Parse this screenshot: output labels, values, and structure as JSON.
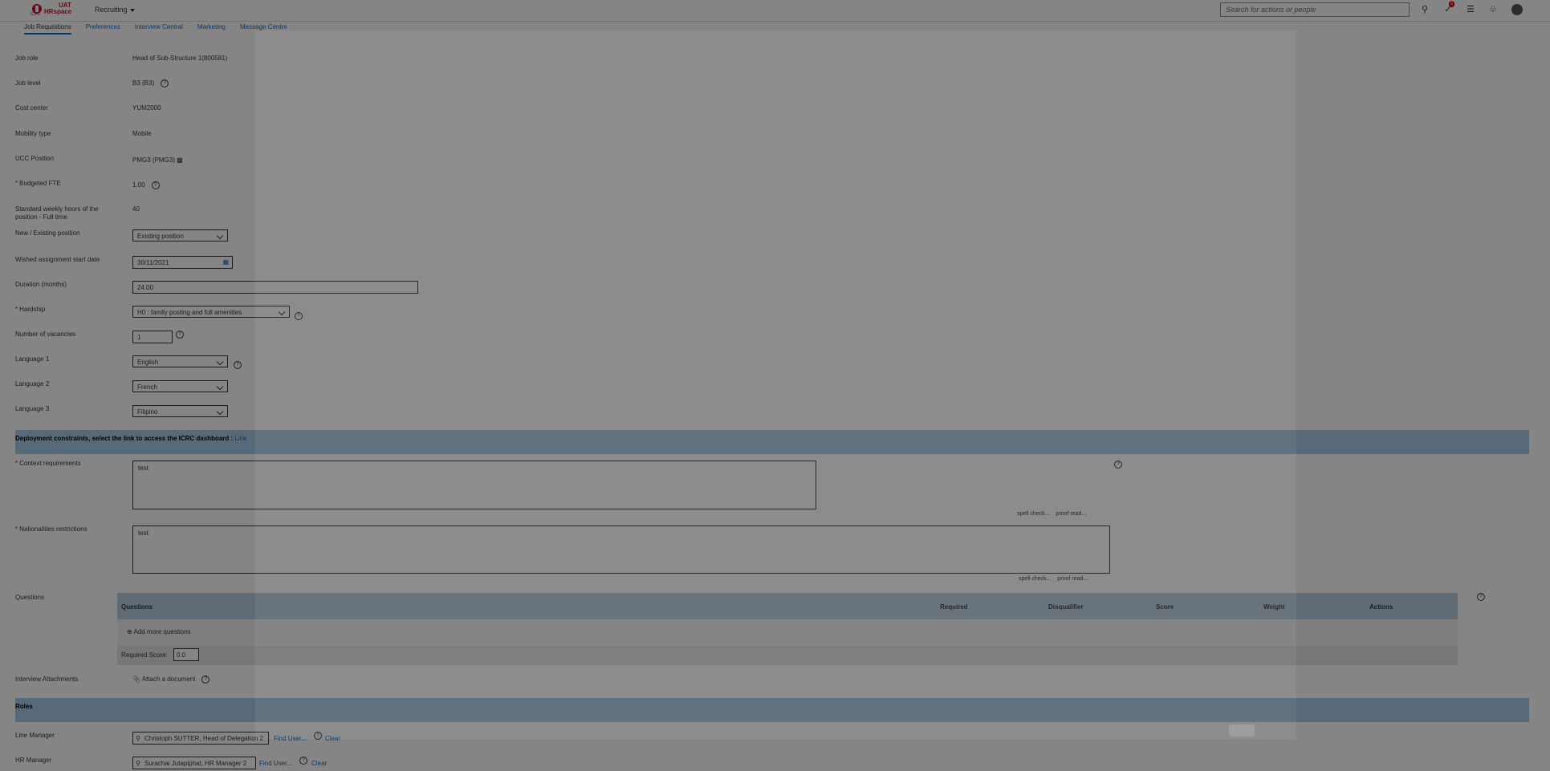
{
  "header": {
    "brand_top": "UAT",
    "brand_bottom": "HRspace",
    "brand_small": "ICRC",
    "module": "Recruiting",
    "search_placeholder": "Search for actions or people",
    "notification_count": "5"
  },
  "tabs": [
    "Job Requisitions",
    "Preferences",
    "Interview Central",
    "Marketing",
    "Message Centre"
  ],
  "fields": {
    "job_role": {
      "label": "Job role",
      "value": "Head of Sub-Structure 1(800581)"
    },
    "job_level": {
      "label": "Job level",
      "value": "B3 (B3)"
    },
    "cost_center": {
      "label": "Cost center",
      "value": "YUM2000"
    },
    "mobility_type": {
      "label": "Mobility type",
      "value": "Mobile"
    },
    "ucc_position": {
      "label": "UCC Position",
      "value": "PMG3 (PMG3)"
    },
    "budgeted_fte": {
      "label": "Budgeted FTE",
      "value": "1.00"
    },
    "weekly_hours": {
      "label": "Standard weekly hours of the position - Full time",
      "value": "40"
    },
    "new_existing": {
      "label": "New / Existing position",
      "value": "Existing position"
    },
    "start_date": {
      "label": "Wished assignment start date",
      "value": "30/11/2021"
    },
    "duration": {
      "label": "Duration (months)",
      "value": "24.00"
    },
    "hardship": {
      "label": "Hardship",
      "value": "H0 : family posting and full amenities"
    },
    "vacancies": {
      "label": "Number of vacancies",
      "value": "1"
    },
    "language1": {
      "label": "Language 1",
      "value": "English"
    },
    "language2": {
      "label": "Language 2",
      "value": "French"
    },
    "language3": {
      "label": "Language 3",
      "value": "Filipino"
    }
  },
  "deployment": {
    "heading": "Deployment constraints, select the link to access the ICRC dashboard :",
    "link": "Link",
    "context_label": "Context requirements",
    "context_value": "test",
    "nationalities_label": "Nationalities restrictions",
    "nationalities_value": "test",
    "spell_check": "spell check...",
    "proof_read": "proof read..."
  },
  "questions": {
    "label": "Questions",
    "columns": [
      "Questions",
      "Required",
      "Disqualifier",
      "Score",
      "Weight",
      "Actions"
    ],
    "add_more": "Add more questions",
    "required_score_label": "Required Score:",
    "required_score_value": "0.0"
  },
  "interview": {
    "label": "Interview Attachments",
    "attach": "Attach a document"
  },
  "roles": {
    "heading": "Roles",
    "line_manager_label": "Line Manager",
    "line_manager_value": "Christoph SUTTER, Head of Delegation 2",
    "hr_manager_label": "HR Manager",
    "hr_manager_value": "Surachai Jutapiphat, HR Manager 2",
    "find_user": "Find User...",
    "clear": "Clear"
  }
}
